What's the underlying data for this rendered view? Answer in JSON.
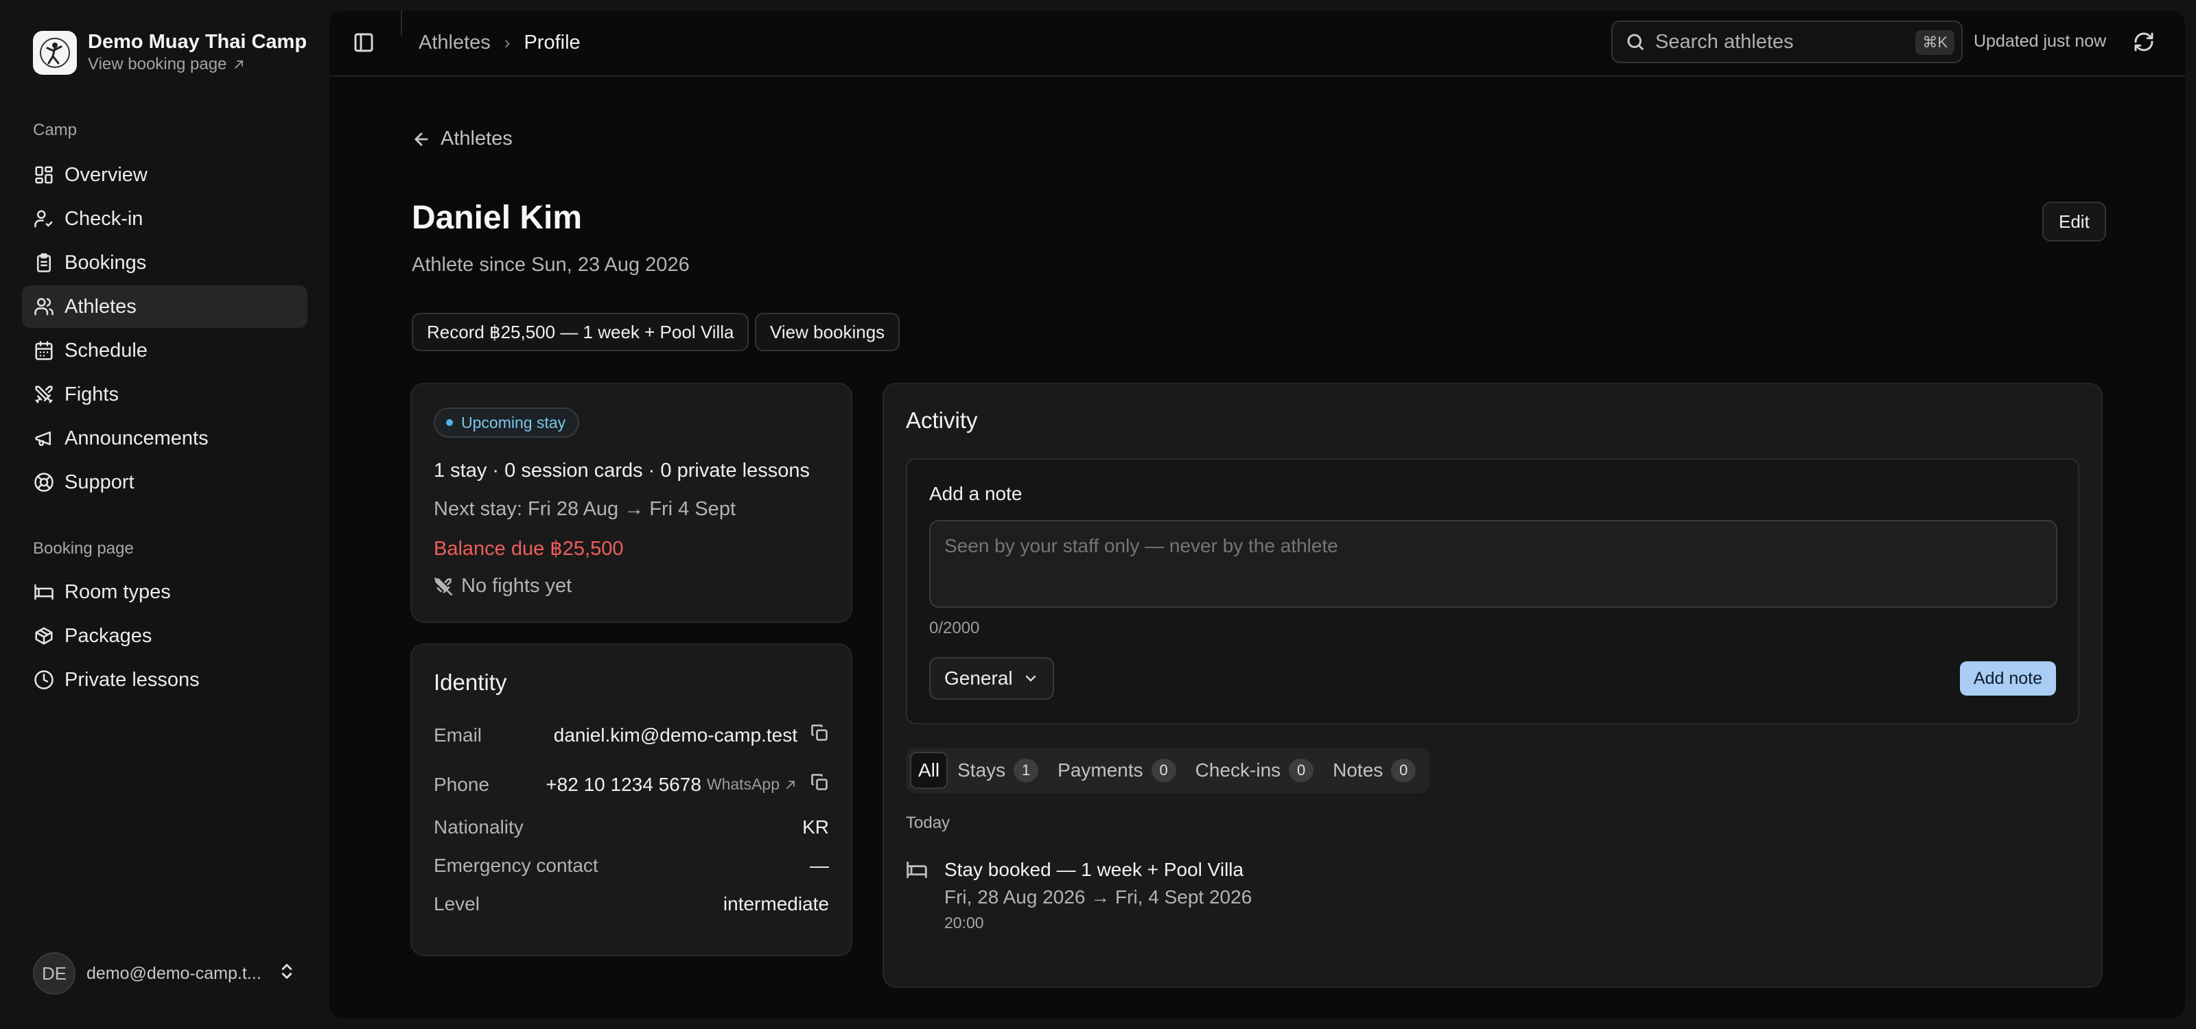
{
  "sidebar": {
    "camp_name": "Demo Muay Thai Camp",
    "booking_link": "View booking page",
    "sections": [
      {
        "label": "Camp"
      },
      {
        "label": "Booking page"
      }
    ],
    "camp_items": [
      {
        "label": "Overview",
        "icon": "dashboard-icon"
      },
      {
        "label": "Check-in",
        "icon": "user-check-icon"
      },
      {
        "label": "Bookings",
        "icon": "clipboard-icon"
      },
      {
        "label": "Athletes",
        "icon": "users-icon",
        "active": true
      },
      {
        "label": "Schedule",
        "icon": "calendar-icon"
      },
      {
        "label": "Fights",
        "icon": "swords-icon"
      },
      {
        "label": "Announcements",
        "icon": "megaphone-icon"
      },
      {
        "label": "Support",
        "icon": "lifebuoy-icon"
      }
    ],
    "booking_items": [
      {
        "label": "Room types",
        "icon": "bed-icon"
      },
      {
        "label": "Packages",
        "icon": "package-icon"
      },
      {
        "label": "Private lessons",
        "icon": "clock-icon"
      }
    ],
    "user": {
      "initials": "DE",
      "email": "demo@demo-camp.t..."
    }
  },
  "topbar": {
    "breadcrumb_parent": "Athletes",
    "breadcrumb_current": "Profile",
    "search_placeholder": "Search athletes",
    "search_shortcut": "⌘K",
    "updated": "Updated just now"
  },
  "profile": {
    "back_label": "Athletes",
    "name": "Daniel Kim",
    "since": "Athlete since Sun, 23 Aug 2026",
    "edit_label": "Edit",
    "record_label": "Record ฿25,500 — 1 week + Pool Villa",
    "view_bookings_label": "View bookings"
  },
  "summary": {
    "badge": "Upcoming stay",
    "counts": "1 stay · 0 session cards · 0 private lessons",
    "next_stay": "Next stay: Fri 28 Aug → Fri 4 Sept",
    "balance": "Balance due ฿25,500",
    "fights": "No fights yet"
  },
  "identity": {
    "title": "Identity",
    "email_label": "Email",
    "email": "daniel.kim@demo-camp.test",
    "phone_label": "Phone",
    "phone": "+82 10 1234 5678",
    "whatsapp": "WhatsApp",
    "nationality_label": "Nationality",
    "nationality": "KR",
    "emergency_label": "Emergency contact",
    "emergency": "—",
    "level_label": "Level",
    "level": "intermediate"
  },
  "activity": {
    "title": "Activity",
    "note_title": "Add a note",
    "note_placeholder": "Seen by your staff only — never by the athlete",
    "counter": "0/2000",
    "category": "General",
    "add_note_label": "Add note",
    "tabs": [
      {
        "label": "All",
        "active": true
      },
      {
        "label": "Stays",
        "count": "1"
      },
      {
        "label": "Payments",
        "count": "0"
      },
      {
        "label": "Check-ins",
        "count": "0"
      },
      {
        "label": "Notes",
        "count": "0"
      }
    ],
    "day_label": "Today",
    "event": {
      "title": "Stay booked — 1 week + Pool Villa",
      "dates": "Fri, 28 Aug 2026 → Fri, 4 Sept 2026",
      "time": "20:00"
    }
  },
  "colors": {
    "background": "#0a0a0a",
    "card": "#1a1a1a",
    "accent": "#a9cdf4",
    "badge_text": "#7cc6ea",
    "balance_due": "#f25c5c"
  }
}
